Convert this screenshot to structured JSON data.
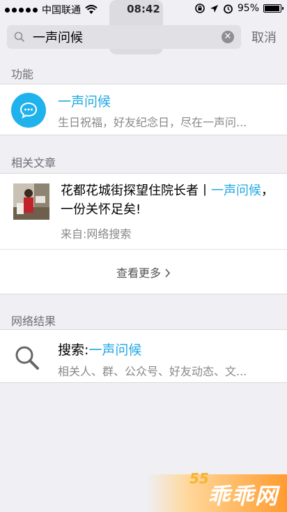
{
  "status_bar": {
    "carrier": "中国联通",
    "time": "08:42",
    "battery": "95%",
    "battery_level": 0.95
  },
  "search": {
    "value": "一声问候",
    "cancel_label": "取消"
  },
  "sections": {
    "function": {
      "header": "功能",
      "item": {
        "title": "一声问候",
        "description": "生日祝福，好友纪念日，尽在一声问...",
        "icon": "chat-bubble-icon"
      }
    },
    "articles": {
      "header": "相关文章",
      "item": {
        "title_prefix": "花都花城街探望住院长者丨",
        "title_highlight": "一声问候",
        "title_suffix": "，一份关怀足矣!",
        "source": "来自:网络搜索"
      },
      "more_label": "查看更多"
    },
    "web": {
      "header": "网络结果",
      "item": {
        "title_prefix": "搜索:",
        "title_highlight": "一声问候",
        "description": "相关人、群、公众号、好友动态、文..."
      }
    }
  },
  "watermark": {
    "text": "乖乖网",
    "number": "55"
  },
  "colors": {
    "accent": "#1fa8e3",
    "icon_bg": "#1fb2ed",
    "background": "#efeff4"
  }
}
